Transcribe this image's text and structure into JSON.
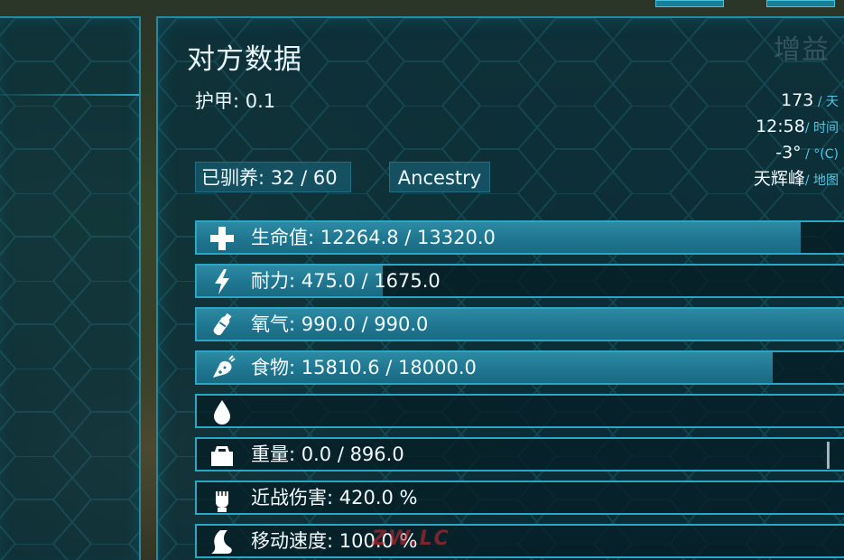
{
  "colors": {
    "panel_bg": "#08303c",
    "border": "#2aa7c4",
    "bar_fill": "#1f7690",
    "text": "#f4fcff",
    "unit_text": "#4fc9e6"
  },
  "buff_panel": {
    "title": "增益"
  },
  "stats_panel": {
    "title": "对方数据",
    "armor": "护甲: 0.1",
    "tamed": "已驯养: 32 / 60",
    "ancestry": "Ancestry"
  },
  "world_info": {
    "day_value": "173",
    "day_unit": " / 天",
    "time_value": "12:58",
    "time_unit": "/ 时间",
    "temp_value": "-3°",
    "temp_unit": " / °(C)",
    "location_value": "天辉峰",
    "location_unit": "/ 地图"
  },
  "stats": [
    {
      "label": "生命值: 12264.8 / 13320.0",
      "fill": 0.9208,
      "icon": "health-cross-icon"
    },
    {
      "label": "耐力: 475.0 / 1675.0",
      "fill": 0.2836,
      "icon": "stamina-lightning-icon"
    },
    {
      "label": "氧气: 990.0 / 990.0",
      "fill": 1.0,
      "icon": "oxygen-tank-icon"
    },
    {
      "label": "食物: 15810.6 / 18000.0",
      "fill": 0.8784,
      "icon": "food-icon"
    },
    {
      "label": "",
      "fill": 0.0,
      "icon": "water-drop-icon"
    },
    {
      "label": "重量: 0.0 / 896.0",
      "fill": 0.0,
      "icon": "weight-icon"
    },
    {
      "label": "近战伤害: 420.0 %",
      "fill": 0.0,
      "icon": "melee-fist-icon"
    },
    {
      "label": "移动速度: 100.0 %",
      "fill": 0.0,
      "icon": "movement-speed-icon"
    }
  ],
  "watermark": "ZW.LC"
}
